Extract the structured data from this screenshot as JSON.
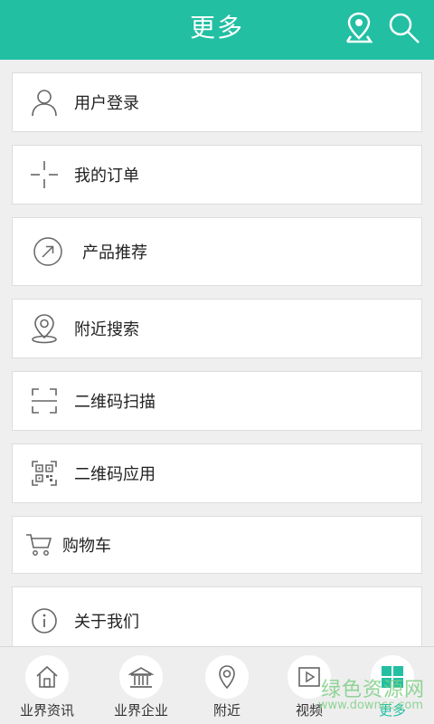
{
  "header": {
    "title": "更多",
    "location_icon": "location-pin-icon",
    "search_icon": "search-icon"
  },
  "menu": [
    {
      "label": "用户登录",
      "icon": "user-icon"
    },
    {
      "label": "我的订单",
      "icon": "crosshair-icon"
    },
    {
      "label": "产品推荐",
      "icon": "arrow-circle-icon"
    },
    {
      "label": "附近搜索",
      "icon": "map-pin-icon"
    },
    {
      "label": "二维码扫描",
      "icon": "scan-frame-icon"
    },
    {
      "label": "二维码应用",
      "icon": "qr-code-icon"
    },
    {
      "label": "购物车",
      "icon": "shopping-cart-icon"
    },
    {
      "label": "关于我们",
      "icon": "info-icon"
    }
  ],
  "tabs": [
    {
      "label": "业界资讯",
      "icon": "home-icon",
      "active": false
    },
    {
      "label": "业界企业",
      "icon": "building-icon",
      "active": false
    },
    {
      "label": "附近",
      "icon": "location-icon",
      "active": false
    },
    {
      "label": "视频",
      "icon": "video-icon",
      "active": false
    },
    {
      "label": "更多",
      "icon": "grid-icon",
      "active": true
    }
  ],
  "watermark": {
    "text": "绿色资源网",
    "url": "www.downcc.com"
  },
  "colors": {
    "accent": "#22bfa3",
    "background": "#efefef"
  }
}
